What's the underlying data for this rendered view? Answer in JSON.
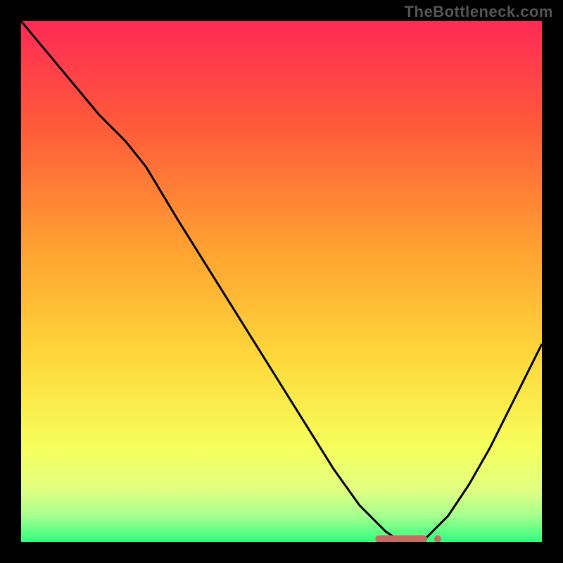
{
  "watermark": "TheBottleneck.com",
  "chart_data": {
    "type": "line",
    "title": "",
    "xlabel": "",
    "ylabel": "",
    "xlim": [
      0,
      100
    ],
    "ylim": [
      0,
      100
    ],
    "series": [
      {
        "name": "bottleneck-curve",
        "x": [
          0,
          5,
          10,
          15,
          20,
          24,
          30,
          35,
          40,
          45,
          50,
          55,
          60,
          65,
          70,
          73,
          76,
          78,
          82,
          86,
          90,
          95,
          100
        ],
        "y": [
          100,
          94,
          88,
          82,
          77,
          72,
          62,
          54,
          46,
          38,
          30,
          22,
          14,
          7,
          2,
          0,
          0,
          1,
          5,
          11,
          18,
          28,
          38
        ],
        "color": "#000000"
      },
      {
        "name": "optimal-marker",
        "x": [
          68,
          70,
          72,
          74,
          76,
          78,
          80
        ],
        "y": [
          0.6,
          0.6,
          0.6,
          0.6,
          0.6,
          0.6,
          0.6
        ],
        "color": "#c46a60"
      }
    ],
    "gradient_stops": [
      {
        "offset": 0,
        "color": "#ff2a55"
      },
      {
        "offset": 20,
        "color": "#ff5a3a"
      },
      {
        "offset": 45,
        "color": "#ffa531"
      },
      {
        "offset": 65,
        "color": "#ffd93b"
      },
      {
        "offset": 82,
        "color": "#f6ff5c"
      },
      {
        "offset": 90,
        "color": "#e2ff82"
      },
      {
        "offset": 95,
        "color": "#a6ff8e"
      },
      {
        "offset": 100,
        "color": "#2fff7d"
      }
    ]
  }
}
